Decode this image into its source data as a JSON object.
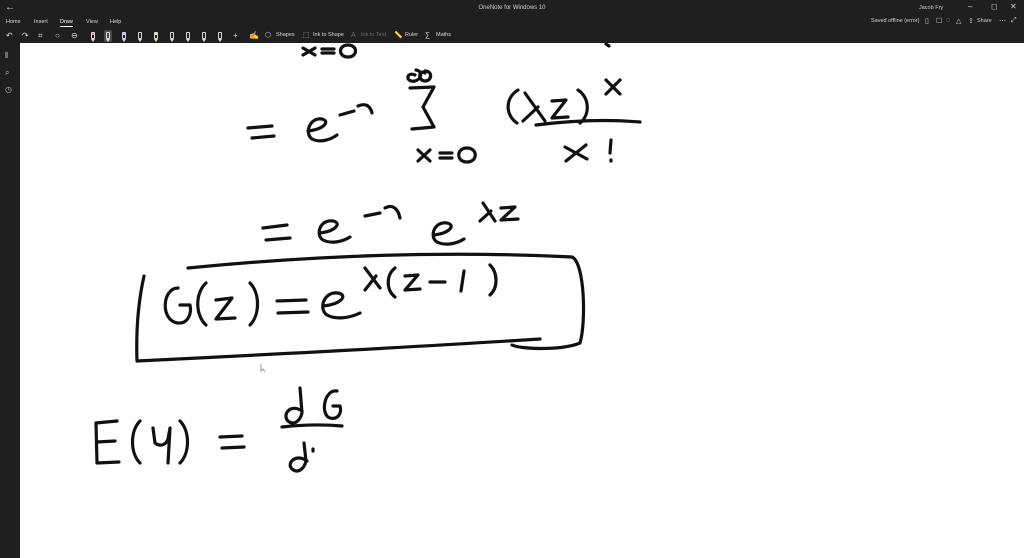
{
  "window": {
    "title": "OneNote for Windows 10",
    "user": "Jacob Fry",
    "back_glyph": "←",
    "minimize_glyph": "–",
    "maximize_glyph": "◻",
    "close_glyph": "✕"
  },
  "menu": {
    "tabs": [
      "Home",
      "Insert",
      "Draw",
      "View",
      "Help"
    ],
    "active": "Draw",
    "status_text": "Saved offline (error)",
    "share_label": "Share"
  },
  "ribbon": {
    "shapes_label": "Shapes",
    "ink_to_shape_label": "Ink to Shape",
    "ink_to_text_label": "Ink to Text",
    "ruler_label": "Ruler",
    "maths_label": "Maths",
    "pen_colors": [
      "#e879c6",
      "#ffffff",
      "#9ad0ff",
      "#ffffff",
      "#f4f25c",
      "#ffffff",
      "#ffffff",
      "#ffffff",
      "#ffffff",
      "#ffffff",
      "#ffffff"
    ]
  },
  "colors": {
    "chrome": "#1f1f1f",
    "canvas": "#ffffff",
    "ink": "#111111"
  }
}
